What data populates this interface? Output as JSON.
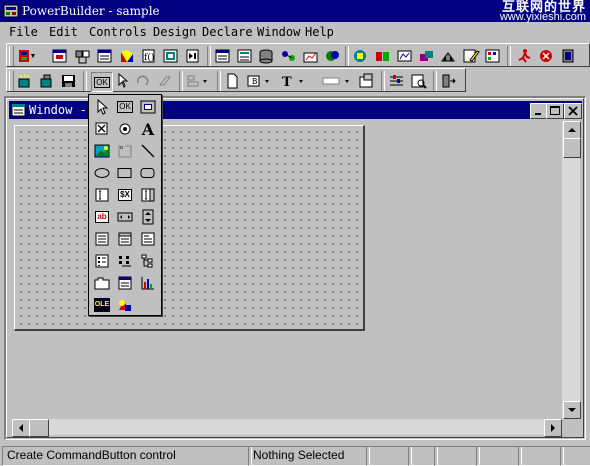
{
  "app": {
    "title": "PowerBuilder - sample",
    "watermark_line1": "互联网的世界",
    "watermark_line2": "www.yixieshi.com"
  },
  "menu": {
    "items": [
      "File",
      "Edit",
      "Controls",
      "Design",
      "Declare",
      "Window",
      "Help"
    ]
  },
  "child_window": {
    "title": "Window - m"
  },
  "palette": {
    "ok_button_label": "OK",
    "ok_small_label": "OK",
    "statictext_glyph": "A",
    "edit_glyph": "ab",
    "mask_glyph": "$X",
    "ole_label": "OLE"
  },
  "toolbar": {
    "ok_button_label": "OK"
  },
  "status": {
    "message": "Create CommandButton control",
    "selection": "Nothing Selected"
  },
  "colors": {
    "titlebar": "#000080",
    "face": "#c0c0c0"
  }
}
